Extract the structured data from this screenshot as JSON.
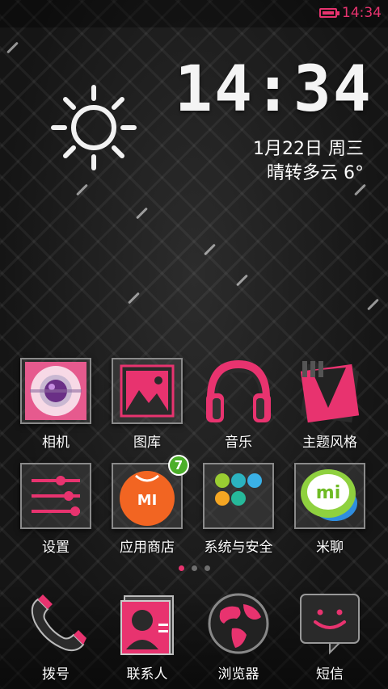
{
  "status_bar": {
    "time": "14:34",
    "battery_icon": "battery-icon"
  },
  "clock_widget": {
    "time": "14:34",
    "date": "1月22日 周三",
    "weather": "晴转多云 6°",
    "weather_icon": "sun-icon"
  },
  "apps_row1": [
    {
      "label": "相机",
      "icon": "camera-icon"
    },
    {
      "label": "图库",
      "icon": "gallery-icon"
    },
    {
      "label": "音乐",
      "icon": "headphones-icon"
    },
    {
      "label": "主题风格",
      "icon": "theme-icon"
    }
  ],
  "apps_row2": [
    {
      "label": "设置",
      "icon": "settings-icon"
    },
    {
      "label": "应用商店",
      "icon": "mi-store-icon",
      "badge": "7"
    },
    {
      "label": "系统与安全",
      "icon": "system-security-icon"
    },
    {
      "label": "米聊",
      "icon": "mitalk-icon"
    }
  ],
  "pager": {
    "pages": 3,
    "active": 1
  },
  "dock": [
    {
      "label": "拨号",
      "icon": "phone-icon"
    },
    {
      "label": "联系人",
      "icon": "contacts-icon"
    },
    {
      "label": "浏览器",
      "icon": "globe-icon"
    },
    {
      "label": "短信",
      "icon": "message-icon"
    }
  ],
  "colors": {
    "accent": "#e8336f",
    "badge": "#4caf2a",
    "store_orange": "#f26522"
  }
}
